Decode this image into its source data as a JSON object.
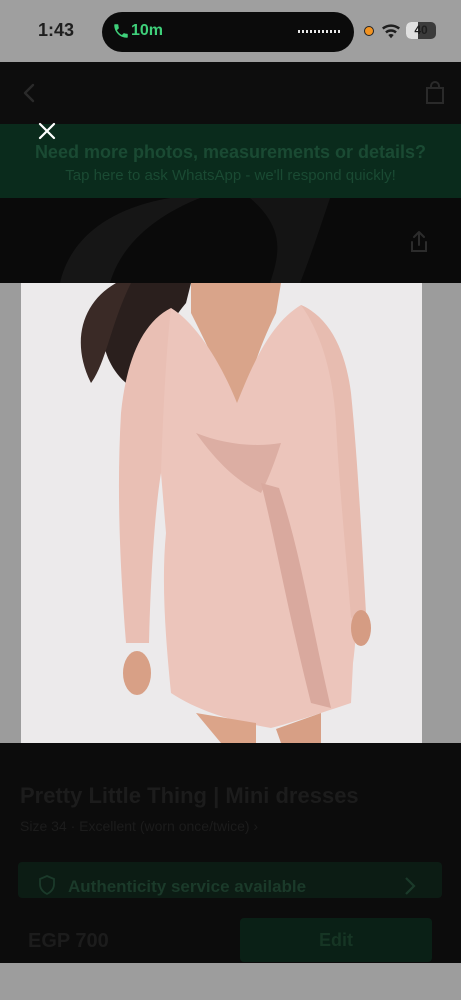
{
  "status_bar": {
    "time": "1:43",
    "call_label": "10m",
    "battery_label": "40",
    "battery_level": 0.4,
    "icons": [
      "phone-icon",
      "wifi-icon",
      "battery-icon"
    ]
  },
  "header": {
    "icons": [
      "back-arrow-icon",
      "shopping-bag-icon"
    ]
  },
  "banner": {
    "title": "Need more photos, measurements or details?",
    "subtitle": "Tap here to ask WhatsApp - we'll respond quickly!"
  },
  "viewer": {
    "close_icon": "close-icon",
    "share_icon": "share-icon"
  },
  "product": {
    "title": "Pretty Little Thing | Mini dresses",
    "meta": "Size 34 · Excellent (worn once/twice) ›",
    "authenticity_label": "Authenticity service available",
    "price": "EGP 700",
    "edit_label": "Edit"
  },
  "colors": {
    "accent_green": "#3fd07a",
    "dress_pink": "#eec7be",
    "image_bg": "#eceaeb"
  }
}
